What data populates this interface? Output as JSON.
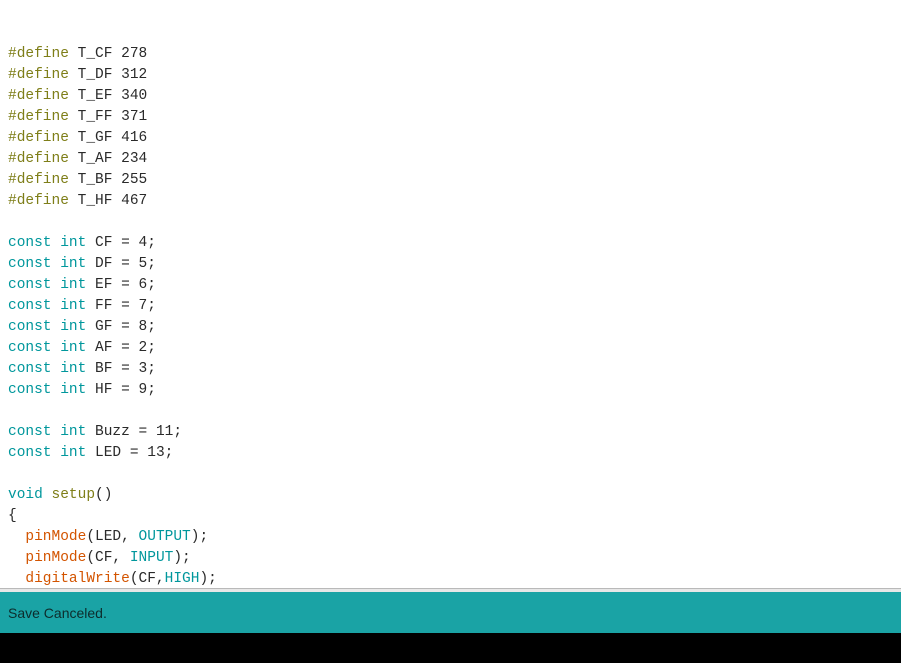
{
  "app": {
    "name": "arduino-ide-editor",
    "accent_color": "#1aa3a5",
    "editor_background": "#ffffff",
    "console_background": "#000000"
  },
  "status_bar": {
    "message": "Save Canceled.",
    "background": "#1aa3a5",
    "text_color": "#0d2c2c"
  },
  "console": {
    "text": ""
  },
  "syntax_colors": {
    "preprocessor": "#7e7e18",
    "keyword": "#00979c",
    "function": "#d35400",
    "plain": "#2a2a2a"
  },
  "code": {
    "lines": [
      {
        "indent": 0,
        "tokens": [
          {
            "t": "#define",
            "c": "pre"
          },
          {
            "t": " T_CF 278",
            "c": "plain"
          }
        ]
      },
      {
        "indent": 0,
        "tokens": [
          {
            "t": "#define",
            "c": "pre"
          },
          {
            "t": " T_DF 312",
            "c": "plain"
          }
        ]
      },
      {
        "indent": 0,
        "tokens": [
          {
            "t": "#define",
            "c": "pre"
          },
          {
            "t": " T_EF 340",
            "c": "plain"
          }
        ]
      },
      {
        "indent": 0,
        "tokens": [
          {
            "t": "#define",
            "c": "pre"
          },
          {
            "t": " T_FF 371",
            "c": "plain"
          }
        ]
      },
      {
        "indent": 0,
        "tokens": [
          {
            "t": "#define",
            "c": "pre"
          },
          {
            "t": " T_GF 416",
            "c": "plain"
          }
        ]
      },
      {
        "indent": 0,
        "tokens": [
          {
            "t": "#define",
            "c": "pre"
          },
          {
            "t": " T_AF 234",
            "c": "plain"
          }
        ]
      },
      {
        "indent": 0,
        "tokens": [
          {
            "t": "#define",
            "c": "pre"
          },
          {
            "t": " T_BF 255",
            "c": "plain"
          }
        ]
      },
      {
        "indent": 0,
        "tokens": [
          {
            "t": "#define",
            "c": "pre"
          },
          {
            "t": " T_HF 467",
            "c": "plain"
          }
        ]
      },
      {
        "indent": 0,
        "tokens": []
      },
      {
        "indent": 0,
        "tokens": [
          {
            "t": "const int",
            "c": "kw"
          },
          {
            "t": " CF = 4;",
            "c": "plain"
          }
        ]
      },
      {
        "indent": 0,
        "tokens": [
          {
            "t": "const int",
            "c": "kw"
          },
          {
            "t": " DF = 5;",
            "c": "plain"
          }
        ]
      },
      {
        "indent": 0,
        "tokens": [
          {
            "t": "const int",
            "c": "kw"
          },
          {
            "t": " EF = 6;",
            "c": "plain"
          }
        ]
      },
      {
        "indent": 0,
        "tokens": [
          {
            "t": "const int",
            "c": "kw"
          },
          {
            "t": " FF = 7;",
            "c": "plain"
          }
        ]
      },
      {
        "indent": 0,
        "tokens": [
          {
            "t": "const int",
            "c": "kw"
          },
          {
            "t": " GF = 8;",
            "c": "plain"
          }
        ]
      },
      {
        "indent": 0,
        "tokens": [
          {
            "t": "const int",
            "c": "kw"
          },
          {
            "t": " AF = 2;",
            "c": "plain"
          }
        ]
      },
      {
        "indent": 0,
        "tokens": [
          {
            "t": "const int",
            "c": "kw"
          },
          {
            "t": " BF = 3;",
            "c": "plain"
          }
        ]
      },
      {
        "indent": 0,
        "tokens": [
          {
            "t": "const int",
            "c": "kw"
          },
          {
            "t": " HF = 9;",
            "c": "plain"
          }
        ]
      },
      {
        "indent": 0,
        "tokens": []
      },
      {
        "indent": 0,
        "tokens": [
          {
            "t": "const int",
            "c": "kw"
          },
          {
            "t": " Buzz = 11;",
            "c": "plain"
          }
        ]
      },
      {
        "indent": 0,
        "tokens": [
          {
            "t": "const int",
            "c": "kw"
          },
          {
            "t": " LED = 13;",
            "c": "plain"
          }
        ]
      },
      {
        "indent": 0,
        "tokens": []
      },
      {
        "indent": 0,
        "tokens": [
          {
            "t": "void",
            "c": "kw"
          },
          {
            "t": " ",
            "c": "plain"
          },
          {
            "t": "setup",
            "c": "pre"
          },
          {
            "t": "()",
            "c": "plain"
          }
        ]
      },
      {
        "indent": 0,
        "tokens": [
          {
            "t": "{",
            "c": "plain"
          }
        ]
      },
      {
        "indent": 2,
        "tokens": [
          {
            "t": "pinMode",
            "c": "fn"
          },
          {
            "t": "(LED, ",
            "c": "plain"
          },
          {
            "t": "OUTPUT",
            "c": "kw"
          },
          {
            "t": ");",
            "c": "plain"
          }
        ]
      },
      {
        "indent": 2,
        "tokens": [
          {
            "t": "pinMode",
            "c": "fn"
          },
          {
            "t": "(CF, ",
            "c": "plain"
          },
          {
            "t": "INPUT",
            "c": "kw"
          },
          {
            "t": ");",
            "c": "plain"
          }
        ]
      },
      {
        "indent": 2,
        "tokens": [
          {
            "t": "digitalWrite",
            "c": "fn"
          },
          {
            "t": "(CF,",
            "c": "plain"
          },
          {
            "t": "HIGH",
            "c": "kw"
          },
          {
            "t": ");",
            "c": "plain"
          }
        ]
      }
    ]
  }
}
